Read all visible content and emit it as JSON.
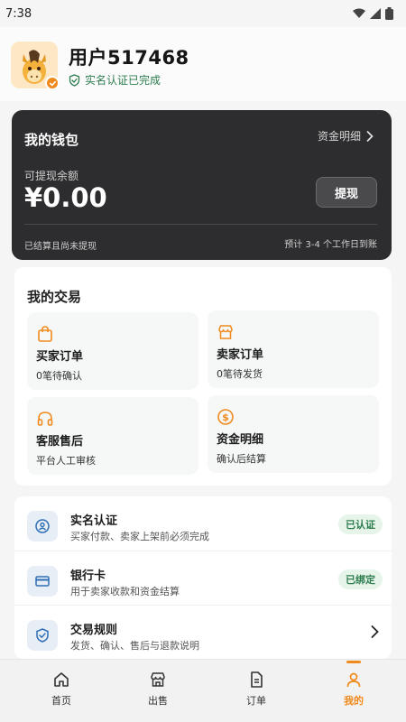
{
  "status_bar": {
    "time": "7:38"
  },
  "profile": {
    "username": "用户517468",
    "verify_text": "实名认证已完成"
  },
  "wallet": {
    "title": "我的钱包",
    "detail_link": "资金明细",
    "balance_label": "可提现余额",
    "balance": "¥0.00",
    "withdraw_label": "提现",
    "footer_left": "已结算且尚未提现",
    "footer_right": "预计 3-4 个工作日到账"
  },
  "trade": {
    "title": "我的交易",
    "tiles": [
      {
        "title": "买家订单",
        "sub": "0笔待确认",
        "icon": "shopping-bag-icon"
      },
      {
        "title": "卖家订单",
        "sub": "0笔待发货",
        "icon": "store-icon"
      },
      {
        "title": "客服售后",
        "sub": "平台人工审核",
        "icon": "headphones-icon"
      },
      {
        "title": "资金明细",
        "sub": "确认后结算",
        "icon": "dollar-coin-icon"
      }
    ]
  },
  "list": {
    "items": [
      {
        "title": "实名认证",
        "sub": "买家付款、卖家上架前必须完成",
        "badge": "已认证",
        "icon": "id-badge-icon"
      },
      {
        "title": "银行卡",
        "sub": "用于卖家收款和资金结算",
        "badge": "已绑定",
        "icon": "credit-card-icon"
      },
      {
        "title": "交易规则",
        "sub": "发货、确认、售后与退款说明",
        "icon": "shield-check-icon"
      }
    ]
  },
  "nav": {
    "items": [
      {
        "label": "首页",
        "icon": "home-icon"
      },
      {
        "label": "出售",
        "icon": "store-icon"
      },
      {
        "label": "订单",
        "icon": "document-icon"
      },
      {
        "label": "我的",
        "icon": "user-icon"
      }
    ]
  },
  "colors": {
    "accent": "#f08a1c",
    "success": "#2e7d4f",
    "wallet_bg": "#2d2d2f",
    "icon_blue": "#2f6fb5"
  }
}
